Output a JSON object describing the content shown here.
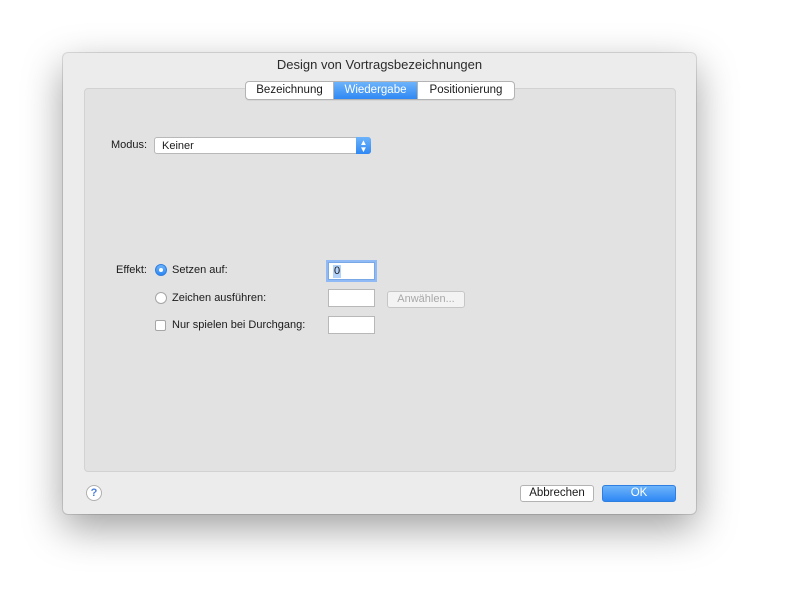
{
  "dialog": {
    "title": "Design von Vortragsbezeichnungen",
    "tabs": [
      {
        "label": "Bezeichnung",
        "active": false
      },
      {
        "label": "Wiedergabe",
        "active": true
      },
      {
        "label": "Positionierung",
        "active": false
      }
    ]
  },
  "modus": {
    "label": "Modus:",
    "value": "Keiner",
    "arrow_icon": "up-down-chevron-icon"
  },
  "effekt": {
    "label": "Effekt:",
    "options": [
      {
        "label": "Setzen auf:",
        "selected": true,
        "value": "0"
      },
      {
        "label": "Zeichen ausführen:",
        "selected": false,
        "value": "",
        "button_label": "Anwählen..."
      }
    ],
    "checkbox": {
      "label": "Nur spielen bei Durchgang:",
      "checked": false,
      "value": ""
    }
  },
  "footer": {
    "help_label": "?",
    "cancel_label": "Abbrechen",
    "ok_label": "OK"
  },
  "colors": {
    "accent": "#2f88f4",
    "dialog_bg": "#ececec",
    "panel_bg": "#e2e2e2"
  }
}
